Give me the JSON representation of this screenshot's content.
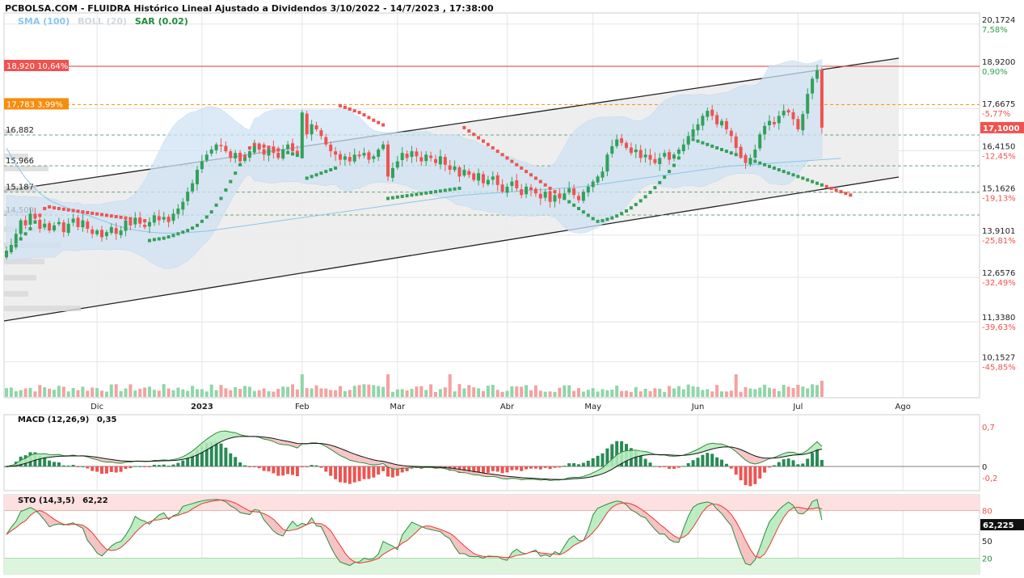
{
  "header": {
    "title": "PCBOLSA.COM - FLUIDRA Histórico Lineal Ajustado a Dividendos 3/10/2022 - 14/7/2023 , 17:38:00"
  },
  "indicators": {
    "sma": {
      "label": "SMA (100)",
      "color": "#8cc4ea"
    },
    "boll": {
      "label": "BOLL (20)",
      "color": "#cfe1f0"
    },
    "sar": {
      "label": "SAR (0.02)",
      "color": "#1f8a3b"
    }
  },
  "colors": {
    "up": "#33a05a",
    "down": "#ef5350",
    "up_vol": "#8fd6a8",
    "down_vol": "#f3a2a0",
    "channel": "#222222",
    "channel_fill": "#ececec",
    "resistance": "#e53935",
    "orange": "#f68d0d",
    "grid": "#e4e4e4"
  },
  "levels_left": [
    {
      "label": "18,920  10,64%",
      "price": 18.92,
      "style": "red"
    },
    {
      "label": "17,783  3,99%",
      "price": 17.783,
      "style": "orange"
    },
    {
      "label": "16,882",
      "price": 16.882,
      "style": "plain"
    },
    {
      "label": "15,966",
      "price": 15.966,
      "style": "plain"
    },
    {
      "label": "15,187",
      "price": 15.187,
      "style": "plain"
    },
    {
      "label": "14,509",
      "price": 14.509,
      "style": "plain"
    }
  ],
  "price_axis": [
    {
      "price": "20,1724",
      "pct": "7,58%",
      "v": 20.1724
    },
    {
      "price": "18,9200",
      "pct": "0,90%",
      "v": 18.92
    },
    {
      "price": "17,6675",
      "pct": "-5,77%",
      "v": 17.6675
    },
    {
      "price": "16,4150",
      "pct": "-12,45%",
      "v": 16.415
    },
    {
      "price": "15,1626",
      "pct": "-19,13%",
      "v": 15.1626
    },
    {
      "price": "13,9101",
      "pct": "-25,81%",
      "v": 13.9101
    },
    {
      "price": "12,6576",
      "pct": "-32,49%",
      "v": 12.6576
    },
    {
      "price": "11,3380",
      "pct": "-39,63%",
      "v": 11.338
    },
    {
      "price": "10,1527",
      "pct": "-45,85%",
      "v": 10.1527
    }
  ],
  "last_price": "17,1000",
  "x_axis": [
    {
      "label": "Dic",
      "bold": false,
      "idx": 19
    },
    {
      "label": "2023",
      "bold": true,
      "idx": 41
    },
    {
      "label": "Feb",
      "bold": false,
      "idx": 62
    },
    {
      "label": "Mar",
      "bold": false,
      "idx": 82
    },
    {
      "label": "Abr",
      "bold": false,
      "idx": 105
    },
    {
      "label": "May",
      "bold": false,
      "idx": 123
    },
    {
      "label": "Jun",
      "bold": false,
      "idx": 145
    },
    {
      "label": "Jul",
      "bold": false,
      "idx": 166
    },
    {
      "label": "Ago",
      "bold": false,
      "idx": 188
    }
  ],
  "macd": {
    "title": "MACD (12,26,9)",
    "value": "0,35",
    "axis": [
      "0,7",
      "0",
      "-0,2"
    ]
  },
  "sto": {
    "title": "STO (14,3,5)",
    "value": "62,22",
    "axis": [
      "80",
      "50",
      "20"
    ],
    "current": "62,225"
  },
  "chart_data": {
    "type": "candlestick",
    "date_range": [
      "3/10/2022",
      "14/7/2023"
    ],
    "ylim": [
      10.0,
      20.2
    ],
    "closes": [
      13.45,
      13.62,
      13.95,
      14.35,
      14.2,
      14.55,
      14.4,
      14.1,
      14.25,
      14.05,
      14.2,
      14.3,
      14.0,
      14.25,
      14.4,
      14.15,
      14.35,
      14.1,
      13.95,
      14.05,
      13.85,
      14.0,
      14.15,
      13.95,
      14.05,
      14.35,
      14.2,
      14.4,
      14.25,
      14.15,
      14.3,
      14.5,
      14.35,
      14.45,
      14.3,
      14.55,
      14.7,
      14.9,
      15.2,
      15.45,
      15.85,
      16.1,
      16.3,
      16.45,
      16.6,
      16.55,
      16.4,
      16.2,
      16.35,
      16.1,
      16.25,
      16.4,
      16.6,
      16.45,
      16.3,
      16.5,
      16.35,
      16.2,
      16.45,
      16.6,
      16.4,
      16.3,
      17.55,
      16.9,
      17.2,
      17.05,
      16.85,
      16.6,
      16.4,
      16.3,
      16.15,
      16.25,
      16.1,
      16.3,
      16.25,
      16.35,
      16.15,
      16.25,
      16.45,
      16.6,
      15.65,
      15.9,
      16.1,
      16.35,
      16.2,
      16.4,
      16.25,
      16.1,
      16.3,
      16.2,
      16.05,
      16.25,
      16.0,
      15.85,
      15.95,
      15.65,
      15.85,
      15.7,
      15.55,
      15.75,
      15.45,
      15.55,
      15.65,
      15.4,
      15.2,
      15.35,
      15.5,
      15.3,
      15.1,
      15.35,
      15.25,
      15.15,
      15.0,
      15.2,
      14.9,
      15.1,
      15.0,
      15.15,
      15.3,
      15.1,
      14.95,
      15.2,
      15.35,
      15.5,
      15.65,
      15.8,
      16.3,
      16.55,
      16.75,
      16.65,
      16.5,
      16.35,
      16.45,
      16.2,
      16.3,
      16.15,
      16.05,
      16.2,
      16.35,
      16.15,
      16.3,
      16.45,
      16.6,
      16.85,
      17.05,
      17.2,
      17.45,
      17.6,
      17.45,
      17.2,
      17.3,
      17.05,
      16.85,
      16.5,
      16.25,
      16.05,
      16.2,
      16.45,
      16.9,
      17.15,
      17.3,
      17.2,
      17.45,
      17.6,
      17.55,
      17.35,
      17.05,
      17.5,
      18.1,
      18.55,
      18.8,
      17.1
    ],
    "ma100": [
      16.5,
      16.25,
      16.0,
      15.8,
      15.6,
      15.45,
      15.3,
      15.15,
      15.05,
      14.95,
      14.88,
      14.82,
      14.76,
      14.7,
      14.65,
      14.6,
      14.55,
      14.5,
      14.45,
      14.4,
      14.35,
      14.3,
      14.25,
      14.2,
      14.16,
      14.12,
      14.09,
      14.06,
      14.04,
      14.02,
      14.0,
      13.99,
      13.98,
      13.97,
      13.97,
      13.97,
      13.98,
      13.98,
      13.99,
      14.0,
      14.01,
      14.02,
      14.03,
      14.05,
      14.07,
      14.09,
      14.11,
      14.13,
      14.15,
      14.17,
      14.19,
      14.21,
      14.23,
      14.25,
      14.27,
      14.29,
      14.31,
      14.33,
      14.35,
      14.37,
      14.39,
      14.41,
      14.43,
      14.45,
      14.47,
      14.49,
      14.51,
      14.53,
      14.55,
      14.57,
      14.59,
      14.61,
      14.63,
      14.65,
      14.67,
      14.69,
      14.71,
      14.73,
      14.75,
      14.77,
      14.79,
      14.81,
      14.83,
      14.85,
      14.87,
      14.89,
      14.91,
      14.93,
      14.95,
      14.97,
      14.99,
      15.01,
      15.03,
      15.05,
      15.07,
      15.09,
      15.1,
      15.11,
      15.12,
      15.13,
      15.14,
      15.15,
      15.16,
      15.17,
      15.18,
      15.19,
      15.2,
      15.21,
      15.22,
      15.23,
      15.24,
      15.25,
      15.26,
      15.27,
      15.28,
      15.29,
      15.3,
      15.31,
      15.32,
      15.33,
      15.34,
      15.35,
      15.37,
      15.39,
      15.41,
      15.43,
      15.45,
      15.47,
      15.49,
      15.51,
      15.53,
      15.55,
      15.57,
      15.59,
      15.61,
      15.63,
      15.65,
      15.67,
      15.69,
      15.71,
      15.73,
      15.75,
      15.77,
      15.79,
      15.81,
      15.83,
      15.85,
      15.87,
      15.89,
      15.91,
      15.93,
      15.95,
      15.96,
      15.97,
      15.98,
      15.99,
      16.0,
      16.01,
      16.02,
      16.03,
      16.04,
      16.05,
      16.06,
      16.07,
      16.08,
      16.09,
      16.1,
      16.11,
      16.12,
      16.13,
      16.14,
      16.15,
      16.16,
      16.17,
      16.18,
      16.19
    ],
    "sar": [
      13.3,
      13.45,
      13.6,
      13.8,
      13.95,
      14.1,
      14.3,
      14.5,
      14.7,
      14.75,
      14.72,
      14.7,
      14.68,
      14.66,
      14.64,
      14.62,
      14.6,
      14.58,
      14.56,
      14.54,
      14.52,
      14.5,
      14.48,
      14.46,
      14.44,
      14.42,
      14.4,
      14.38,
      14.36,
      14.34,
      13.75,
      13.78,
      13.8,
      13.82,
      13.86,
      13.9,
      13.95,
      14.0,
      14.05,
      14.12,
      14.2,
      14.32,
      14.45,
      14.6,
      14.8,
      15.0,
      15.25,
      15.5,
      15.75,
      16.0,
      16.25,
      16.5,
      16.6,
      16.58,
      16.55,
      16.52,
      16.48,
      16.44,
      16.4,
      16.36,
      16.32,
      16.28,
      16.24,
      15.6,
      15.65,
      15.7,
      15.75,
      15.8,
      15.85,
      15.9,
      17.75,
      17.7,
      17.65,
      17.6,
      17.55,
      17.48,
      17.4,
      17.32,
      17.25,
      17.18,
      15.0,
      15.02,
      15.04,
      15.06,
      15.08,
      15.1,
      15.12,
      15.14,
      15.16,
      15.18,
      15.2,
      15.22,
      15.24,
      15.26,
      15.28,
      15.3,
      17.1,
      17.0,
      16.9,
      16.8,
      16.7,
      16.6,
      16.5,
      16.4,
      16.3,
      16.2,
      16.1,
      16.0,
      15.9,
      15.8,
      15.7,
      15.6,
      15.5,
      15.4,
      15.3,
      15.2,
      15.1,
      15.0,
      14.9,
      14.8,
      14.7,
      14.6,
      14.5,
      14.4,
      14.32,
      14.34,
      14.38,
      14.42,
      14.48,
      14.55,
      14.63,
      14.72,
      14.82,
      14.93,
      15.05,
      15.18,
      15.32,
      15.47,
      15.63,
      15.8,
      15.98,
      16.2,
      16.45,
      16.7,
      16.75,
      16.7,
      16.65,
      16.6,
      16.55,
      16.5,
      16.45,
      16.4,
      16.35,
      16.3,
      16.25,
      16.2,
      16.15,
      16.1,
      16.05,
      16.0,
      15.95,
      15.9,
      15.85,
      15.8,
      15.75,
      15.7,
      15.65,
      15.6,
      15.55,
      15.5,
      15.45,
      15.4,
      15.35,
      15.3,
      15.25,
      15.2,
      15.15,
      15.1
    ]
  }
}
